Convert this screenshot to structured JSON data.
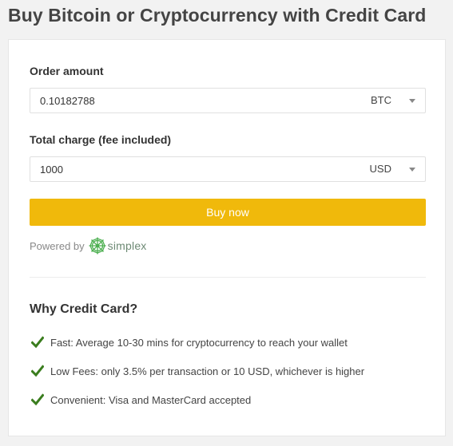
{
  "page": {
    "title": "Buy Bitcoin or Cryptocurrency with Credit Card"
  },
  "order": {
    "amount_label": "Order amount",
    "amount_value": "0.10182788",
    "amount_currency": "BTC",
    "charge_label": "Total charge (fee included)",
    "charge_value": "1000",
    "charge_currency": "USD",
    "buy_label": "Buy now"
  },
  "powered": {
    "prefix": "Powered by",
    "brand": "simplex"
  },
  "why": {
    "title": "Why Credit Card?",
    "items": [
      {
        "text": "Fast: Average 10-30 mins for cryptocurrency to reach your wallet"
      },
      {
        "text": "Low Fees: only 3.5% per transaction or 10 USD, whichever is higher"
      },
      {
        "text": "Convenient: Visa and MasterCard accepted"
      }
    ]
  },
  "colors": {
    "accent": "#f0b90b",
    "check": "#3a7d1e",
    "brand_green": "#6d8a74"
  },
  "icons": {
    "select_arrow": "chevron-down-icon",
    "benefit_marker": "check-icon",
    "brand_logo": "simplex-logo-icon"
  }
}
